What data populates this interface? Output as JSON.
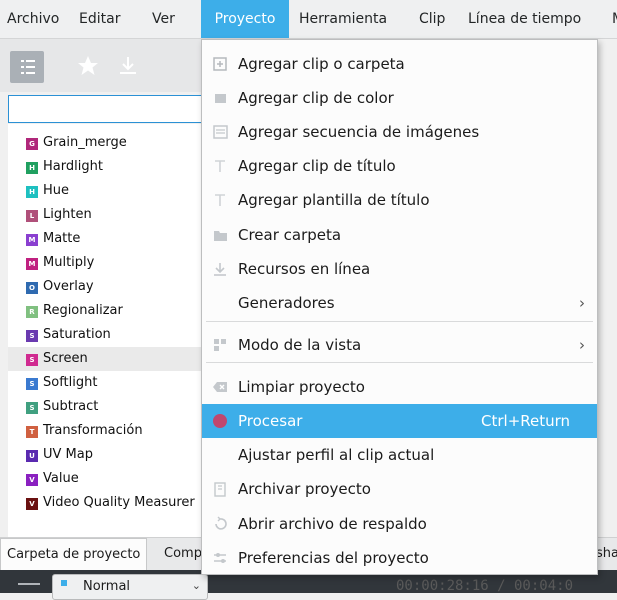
{
  "menubar": {
    "items": [
      "Archivo",
      "Editar",
      "Ver",
      "Proyecto",
      "Herramienta",
      "Clip",
      "Línea de tiempo",
      "M"
    ],
    "active": "Proyecto"
  },
  "search": {
    "value": "",
    "placeholder": ""
  },
  "effects_list": [
    {
      "label": "Grain_merge",
      "letter": "G",
      "color": "#b0277a"
    },
    {
      "label": "Hardlight",
      "letter": "H",
      "color": "#20a060"
    },
    {
      "label": "Hue",
      "letter": "H",
      "color": "#1ec0c0"
    },
    {
      "label": "Lighten",
      "letter": "L",
      "color": "#b0507a"
    },
    {
      "label": "Matte",
      "letter": "M",
      "color": "#8a3fd0"
    },
    {
      "label": "Multiply",
      "letter": "M",
      "color": "#c02080"
    },
    {
      "label": "Overlay",
      "letter": "O",
      "color": "#2f6ab0"
    },
    {
      "label": "Regionalizar",
      "letter": "R",
      "color": "#80c080"
    },
    {
      "label": "Saturation",
      "letter": "S",
      "color": "#6a3ab0"
    },
    {
      "label": "Screen",
      "letter": "S",
      "color": "#d02a90"
    },
    {
      "label": "Softlight",
      "letter": "S",
      "color": "#3a7ad0"
    },
    {
      "label": "Subtract",
      "letter": "S",
      "color": "#40a080"
    },
    {
      "label": "Transformación",
      "letter": "T",
      "color": "#d06040"
    },
    {
      "label": "UV Map",
      "letter": "U",
      "color": "#5a2ab0"
    },
    {
      "label": "Value",
      "letter": "V",
      "color": "#8a20c0"
    },
    {
      "label": "Video Quality Measurer",
      "letter": "V",
      "color": "#6a1010"
    }
  ],
  "selected_effect": "Screen",
  "tabs": {
    "items": [
      "Carpeta de proyecto",
      "Comp",
      "sha"
    ],
    "active": "Carpeta de proyecto"
  },
  "bottombar": {
    "mode": "Normal",
    "timecode": "00:00:28:16 / 00:04:0"
  },
  "menu": {
    "items": [
      {
        "label": "Agregar clip o carpeta",
        "icon": "add-clip-icon",
        "enabled": true
      },
      {
        "label": "Agregar clip de color",
        "icon": "color-clip-icon",
        "enabled": true
      },
      {
        "label": "Agregar secuencia de imágenes",
        "icon": "image-sequence-icon",
        "enabled": true
      },
      {
        "label": "Agregar clip de título",
        "icon": "title-clip-icon",
        "enabled": true
      },
      {
        "label": "Agregar plantilla de título",
        "icon": "title-template-icon",
        "enabled": true
      },
      {
        "label": "Crear carpeta",
        "icon": "folder-icon",
        "enabled": true
      },
      {
        "label": "Recursos en línea",
        "icon": "download-icon",
        "enabled": true
      },
      {
        "label": "Generadores",
        "icon": "",
        "enabled": true,
        "submenu": true
      },
      {
        "label": "Modo de la vista",
        "icon": "view-mode-icon",
        "enabled": true,
        "submenu": true
      },
      {
        "label": "Limpiar proyecto",
        "icon": "clear-icon",
        "enabled": true
      },
      {
        "label": "Procesar",
        "icon": "render-icon",
        "enabled": true,
        "shortcut": "Ctrl+Return",
        "highlight": true
      },
      {
        "label": "Ajustar perfil al clip actual",
        "icon": "",
        "enabled": true
      },
      {
        "label": "Archivar proyecto",
        "icon": "archive-icon",
        "enabled": true
      },
      {
        "label": "Abrir archivo de respaldo",
        "icon": "backup-icon",
        "enabled": true
      },
      {
        "label": "Preferencias del proyecto",
        "icon": "preferences-icon",
        "enabled": true
      }
    ]
  },
  "colors": {
    "accent": "#3daee9",
    "render_dot": "#c0476e"
  }
}
